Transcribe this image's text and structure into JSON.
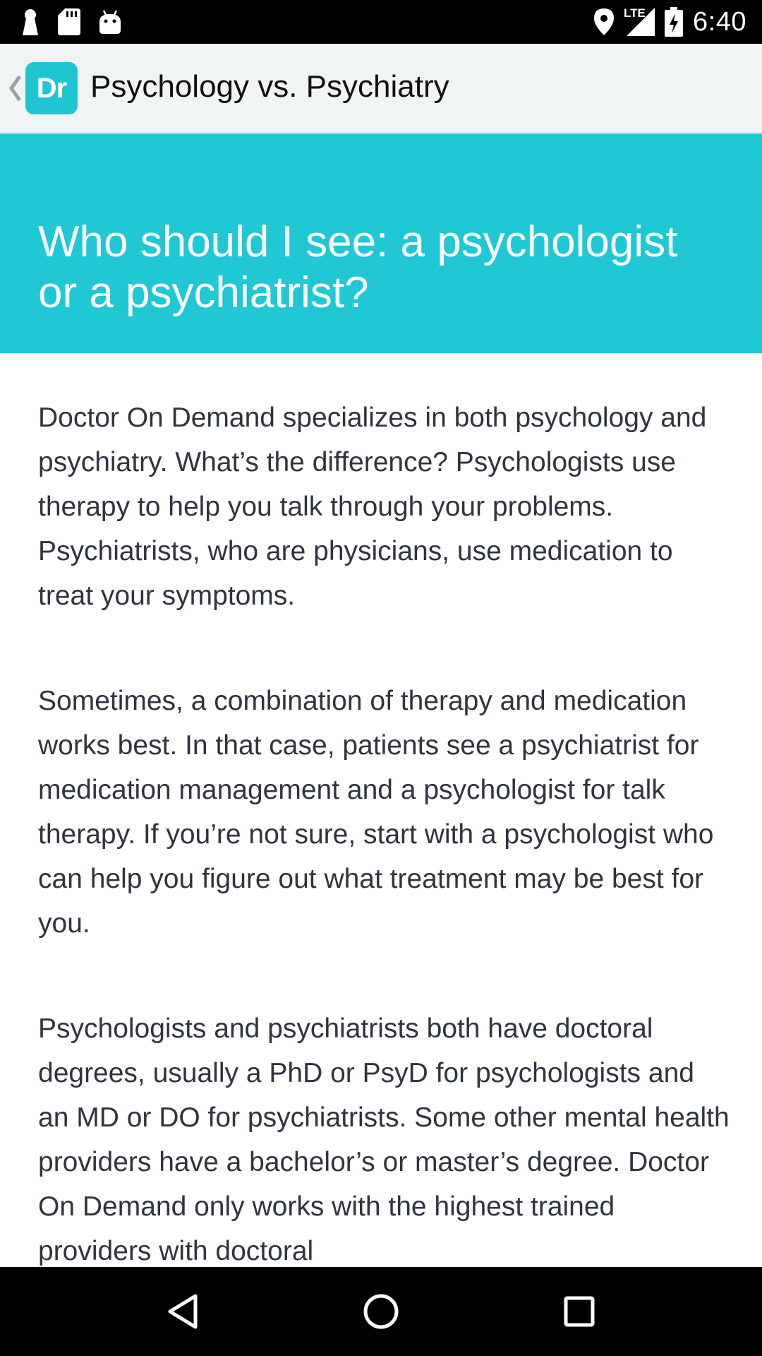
{
  "status_bar": {
    "time": "6:40",
    "network_label": "LTE",
    "icons": [
      "keyhole-icon",
      "sd-card-icon",
      "android-icon",
      "location-icon",
      "signal-icon",
      "battery-charging-icon"
    ]
  },
  "app_bar": {
    "logo_text": "Dr",
    "title": "Psychology vs. Psychiatry"
  },
  "hero": {
    "title": "Who should I see: a psychologist or a psychiatrist?"
  },
  "article": {
    "paragraphs": [
      "Doctor On Demand specializes in both psychology and psychiatry. What’s the difference? Psychologists use therapy to help you talk through your problems. Psychiatrists, who are physicians, use medication to treat your symptoms.",
      "Sometimes, a combination of therapy and medication works best. In that case, patients see a psychiatrist for medication management and a psychologist for talk therapy. If you’re not sure, start with a psychologist who can help you figure out what treatment may be best for you.",
      "Psychologists and psychiatrists both have doctoral degrees, usually a PhD or PsyD for psychologists and an MD or DO for psychiatrists. Some other mental health providers have a bachelor’s or master’s degree. Doctor On Demand only works with the highest trained providers with doctoral"
    ]
  },
  "nav_bar": {
    "buttons": [
      "back-triangle-icon",
      "home-circle-icon",
      "recents-square-icon"
    ]
  },
  "colors": {
    "accent": "#1fc8d4",
    "app_bar_bg": "#f1f4f5",
    "body_text": "#2e3440"
  }
}
